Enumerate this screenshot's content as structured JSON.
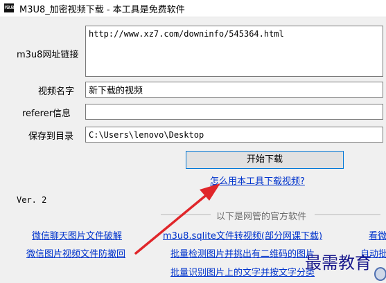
{
  "window": {
    "title": "M3U8_加密视频下载 - 本工具是免费软件"
  },
  "form": {
    "url_label": "m3u8网址链接",
    "url_value": "http://www.xz7.com/downinfo/545364.html",
    "name_label": "视频名字",
    "name_value": "新下载的视频",
    "referer_label": "referer信息",
    "referer_value": "",
    "save_label": "保存到目录",
    "save_value": "C:\\Users\\lenovo\\Desktop",
    "start_button": "开始下载",
    "howto_link": "怎么用本工具下载视频?"
  },
  "version": "Ver. 2",
  "official": {
    "header": "以下是网管的官方软件",
    "links": [
      "微信聊天图片文件破解",
      "微信图片视频文件防撤回",
      "m3u8.sqlite文件转视频(部分网课下载)",
      "批量检测图片并挑出有二维码的图片",
      "批量识别图片上的文字并按文字分类",
      "看微",
      "自动批"
    ]
  },
  "watermark": "最需教育"
}
